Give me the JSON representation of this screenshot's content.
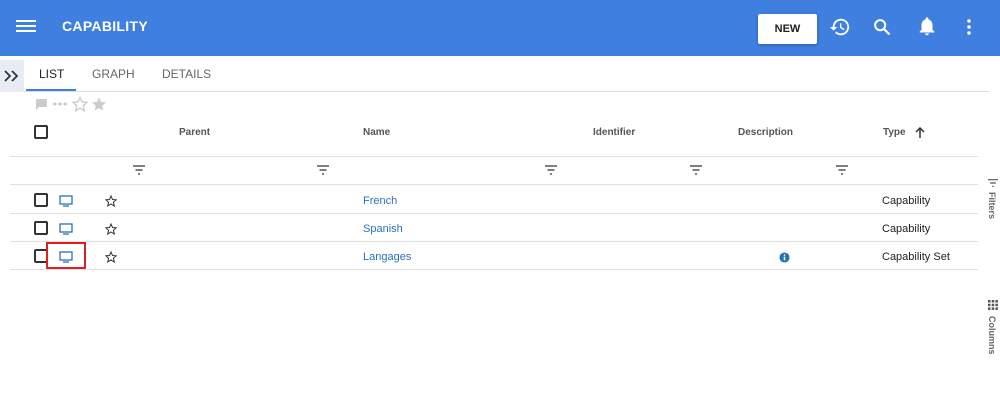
{
  "header": {
    "title": "CAPABILITY",
    "new_label": "NEW",
    "bg_color": "#3f7fe0"
  },
  "tabs": [
    {
      "label": "LIST",
      "active": true
    },
    {
      "label": "GRAPH",
      "active": false
    },
    {
      "label": "DETAILS",
      "active": false
    }
  ],
  "table": {
    "columns": [
      "Parent",
      "Name",
      "Identifier",
      "Description",
      "Type"
    ],
    "sort_column": "Type",
    "sort_direction": "ascending",
    "rows": [
      {
        "name": "French",
        "type": "Capability",
        "has_info": false
      },
      {
        "name": "Spanish",
        "type": "Capability",
        "has_info": false
      },
      {
        "name": "Langages",
        "type": "Capability Set",
        "has_info": true
      }
    ]
  },
  "side_panel": {
    "filters_label": "Filters",
    "columns_label": "Columns"
  },
  "icons": {
    "menu": "hamburger-menu-icon",
    "history": "history-icon",
    "search": "search-icon",
    "notifications": "bell-icon",
    "more": "vertical-dots-icon",
    "row_type": "monitor-icon",
    "favorite": "star-outline-icon",
    "info": "info-icon"
  },
  "highlight_color": "#e02020",
  "link_color": "#2a72b8"
}
